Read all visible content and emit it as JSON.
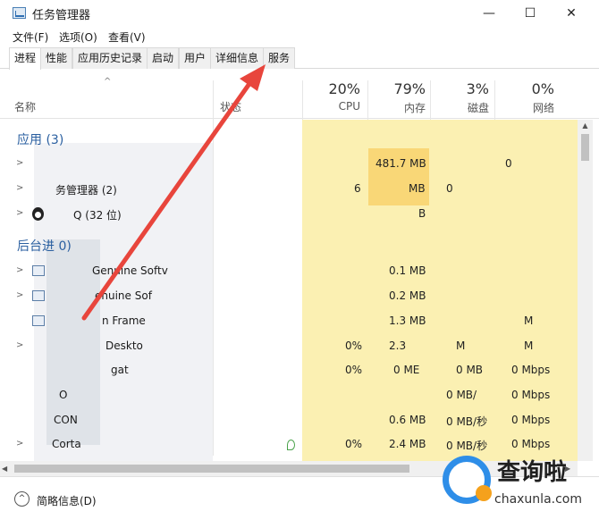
{
  "window": {
    "title": "任务管理器",
    "minimize": "—",
    "maximize": "☐",
    "close": "✕"
  },
  "menu": [
    "文件(F)",
    "选项(O)",
    "查看(V)"
  ],
  "tabs": [
    "进程",
    "性能",
    "应用历史记录",
    "启动",
    "用户",
    "详细信息",
    "服务"
  ],
  "header": {
    "name": "名称",
    "status": "状态",
    "columns": [
      {
        "pct": "20%",
        "label": "CPU"
      },
      {
        "pct": "79%",
        "label": "内存"
      },
      {
        "pct": "3%",
        "label": "磁盘"
      },
      {
        "pct": "0%",
        "label": "网络"
      }
    ]
  },
  "groups": {
    "apps": "应用 (3)",
    "background": "后台进          0)"
  },
  "rows": [
    {
      "name": "",
      "cpu": "",
      "mem": "481.7 MB",
      "disk": "",
      "net": "0"
    },
    {
      "name": "务管理器 (2)",
      "cpu": "6",
      "mem": "MB",
      "disk": "0",
      "net": ""
    },
    {
      "name": "Q (32 位)",
      "cpu": "",
      "mem": "B",
      "disk": "",
      "net": ""
    },
    {
      "name": "Genuine Softv",
      "cpu": "",
      "mem": "0.1 MB",
      "disk": "",
      "net": ""
    },
    {
      "name": "enuine Sof",
      "cpu": "",
      "mem": "0.2 MB",
      "disk": "",
      "net": ""
    },
    {
      "name": "n Frame",
      "cpu": "",
      "mem": "1.3 MB",
      "disk": "",
      "net": "M"
    },
    {
      "name": "Deskto",
      "cpu": "0%",
      "mem": "2.3",
      "disk": "M",
      "net": "M"
    },
    {
      "name": "gat",
      "cpu": "0%",
      "mem": "0 ME",
      "disk": "0 MB",
      "net": "0 Mbps"
    },
    {
      "name": "O",
      "cpu": "",
      "mem": "",
      "disk": "0 MB/",
      "net": "0 Mbps"
    },
    {
      "name": "CON",
      "cpu": "",
      "mem": "0.6 MB",
      "disk": "0 MB/秒",
      "net": "0 Mbps"
    },
    {
      "name": "Corta",
      "cpu": "0%",
      "mem": "2.4 MB",
      "disk": "0 MB/秒",
      "net": "0 Mbps"
    }
  ],
  "footer": {
    "fewer_details": "简略信息(D)"
  },
  "watermark": {
    "brand": "查询啦",
    "site": "chaxunla.com"
  },
  "colors": {
    "arrow": "#e8453c",
    "metric_bg": "#fbf0b2",
    "group_title": "#2a5fa0"
  }
}
